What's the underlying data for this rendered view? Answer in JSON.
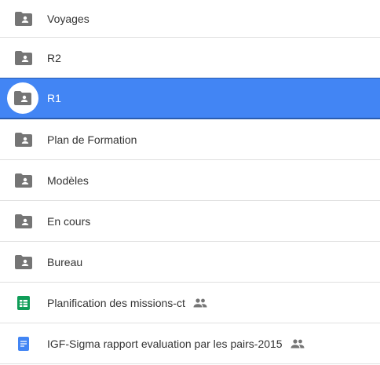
{
  "items": [
    {
      "label": "Voyages",
      "type": "shared-folder",
      "icon": "shared-folder-icon",
      "selected": false,
      "shared": false
    },
    {
      "label": "R2",
      "type": "shared-folder",
      "icon": "shared-folder-icon",
      "selected": false,
      "shared": false
    },
    {
      "label": "R1",
      "type": "shared-folder",
      "icon": "shared-folder-icon",
      "selected": true,
      "shared": false
    },
    {
      "label": "Plan de Formation",
      "type": "shared-folder",
      "icon": "shared-folder-icon",
      "selected": false,
      "shared": false
    },
    {
      "label": "Modèles",
      "type": "shared-folder",
      "icon": "shared-folder-icon",
      "selected": false,
      "shared": false
    },
    {
      "label": "En cours",
      "type": "shared-folder",
      "icon": "shared-folder-icon",
      "selected": false,
      "shared": false
    },
    {
      "label": "Bureau",
      "type": "shared-folder",
      "icon": "shared-folder-icon",
      "selected": false,
      "shared": false
    },
    {
      "label": "Planification des missions-ct",
      "type": "spreadsheet",
      "icon": "spreadsheet-icon",
      "selected": false,
      "shared": true
    },
    {
      "label": "IGF-Sigma rapport evaluation par les pairs-2015",
      "type": "document",
      "icon": "document-icon",
      "selected": false,
      "shared": true
    }
  ],
  "colors": {
    "selection": "#4285f4",
    "folder": "#757575",
    "sheets": "#0f9d58",
    "docs": "#4285f4"
  }
}
